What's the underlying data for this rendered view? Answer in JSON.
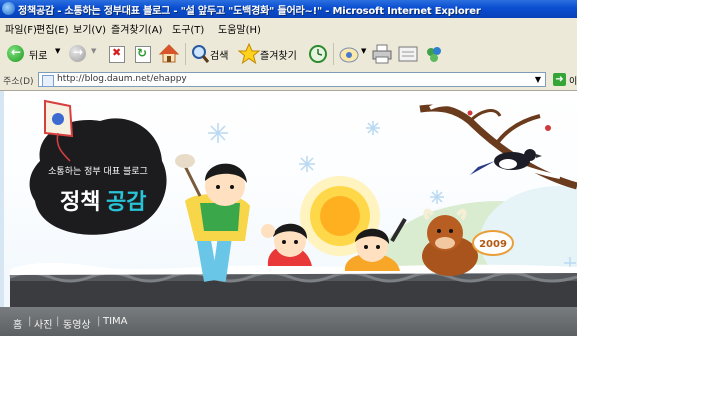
{
  "window": {
    "title": "정책공감 - 소통하는 정부대표 블로그 - \"설 앞두고 \"도백경화\" 들어라~!\" - Microsoft Internet Explorer"
  },
  "menu": [
    "파일(F)",
    "편집(E)",
    "보기(V)",
    "즐겨찾기(A)",
    "도구(T)",
    "도움말(H)"
  ],
  "toolbar": {
    "back_label": "뒤로",
    "search_label": "검색",
    "favorites_label": "즐겨찾기"
  },
  "address": {
    "label": "주소(D)",
    "url": "http://blog.daum.net/ehappy",
    "go_label": "이"
  },
  "banner": {
    "tagline": "소통하는 정부 대표 블로그",
    "logo_part1": "정책",
    "logo_part2": "공감",
    "year": "2009"
  },
  "nav": [
    "홈",
    "사진",
    "동영상",
    "TIMA"
  ],
  "colors": {
    "titlebar": "#0a4ed0",
    "chrome": "#ece9d8",
    "logo_blob": "#1c1c1f",
    "logo_accent": "#29c3d8",
    "navbar": "#6a6d70"
  }
}
